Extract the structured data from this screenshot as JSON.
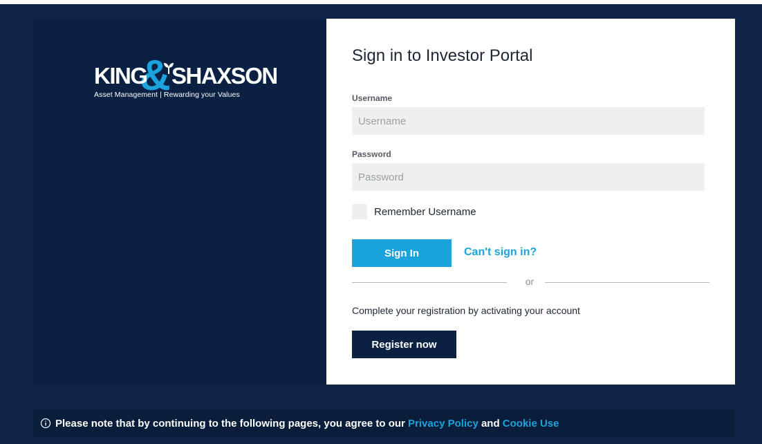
{
  "brand": {
    "logo_part_a": "KING",
    "logo_ampersand": "&",
    "logo_part_b": "SHAXSON",
    "tagline": "Asset Management | Rewarding your Values",
    "colors": {
      "navy": "#0a2143",
      "accent": "#1ba3db"
    }
  },
  "form": {
    "title": "Sign in to Investor Portal",
    "username_label": "Username",
    "username_placeholder": "Username",
    "username_value": "",
    "password_label": "Password",
    "password_placeholder": "Password",
    "password_value": "",
    "remember_label": "Remember Username",
    "remember_checked": false,
    "signin_label": "Sign In",
    "cant_signin_label": "Can't sign in?",
    "divider_label": "or",
    "activation_text": "Complete your registration by activating your account",
    "register_label": "Register now"
  },
  "notice": {
    "icon": "info-icon",
    "prefix": "Please note that by continuing to the following pages, you agree to our",
    "privacy_link": "Privacy Policy",
    "conjunction": "and",
    "cookie_link": "Cookie Use"
  }
}
